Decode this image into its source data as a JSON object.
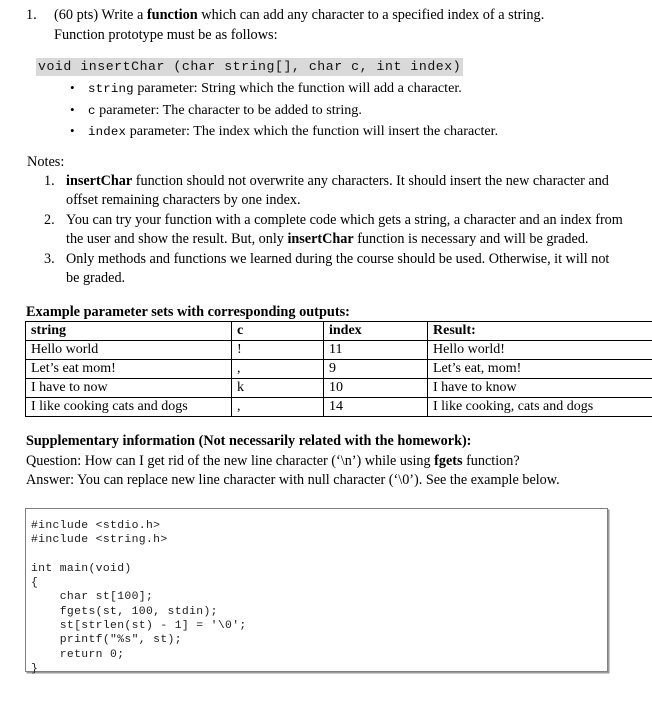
{
  "question": {
    "number": "1.",
    "points_prefix": "(60 pts) Write a ",
    "bold_word": "function",
    "line1_rest": " which can add any character to a specified index of a string.",
    "line2": "Function prototype must be as follows:",
    "prototype": "void insertChar (char string[], char c, int index)",
    "bullets": [
      {
        "marker": "•",
        "code": "string",
        "text": " parameter: String which the function will add a character."
      },
      {
        "marker": "•",
        "code": "c",
        "text": " parameter: The character to be added to string."
      },
      {
        "marker": "•",
        "code": "index",
        "text": " parameter: The index which the function will insert the character."
      }
    ]
  },
  "notes": {
    "label": "Notes:",
    "items": [
      {
        "number": "1.",
        "bold_lead": "insertChar",
        "text": " function should not overwrite any characters. It should insert the new character and offset remaining characters by one index."
      },
      {
        "number": "2.",
        "part1": "You can try your function with a complete code which gets a string, a character and an index from the user and show the result. But, only ",
        "bold_mid": "insertChar",
        "part2": " function is necessary and will be graded."
      },
      {
        "number": "3.",
        "text": "Only methods and functions we learned during the course should be used. Otherwise, it will not be graded."
      }
    ]
  },
  "example": {
    "heading": "Example parameter sets with corresponding outputs:",
    "columns": [
      "string",
      "c",
      "index",
      "Result:"
    ],
    "rows": [
      [
        "Hello world",
        "!",
        "11",
        "Hello world!"
      ],
      [
        "Let’s eat mom!",
        ",",
        "9",
        "Let’s eat, mom!"
      ],
      [
        "I have to now",
        "k",
        "10",
        "I have to know"
      ],
      [
        "I like cooking cats and dogs",
        ",",
        "14",
        "I like cooking, cats and dogs"
      ]
    ]
  },
  "supplementary": {
    "title": "Supplementary information (Not necessarily related with the homework):",
    "question_prefix": "Question: How can I get rid of the new line character (‘\\n’) while using ",
    "question_bold": "fgets",
    "question_suffix": " function?",
    "answer": "Answer: You can replace new line character with null character (‘\\0’). See the example below."
  },
  "code_sample": {
    "language": "c",
    "text": "#include <stdio.h>\n#include <string.h>\n\nint main(void)\n{\n    char st[100];\n    fgets(st, 100, stdin);\n    st[strlen(st) - 1] = '\\0';\n    printf(\"%s\", st);\n    return 0;\n}"
  },
  "colors": {
    "highlight": "#d9d9d9",
    "code_border": "#808080",
    "text": "#000000"
  }
}
